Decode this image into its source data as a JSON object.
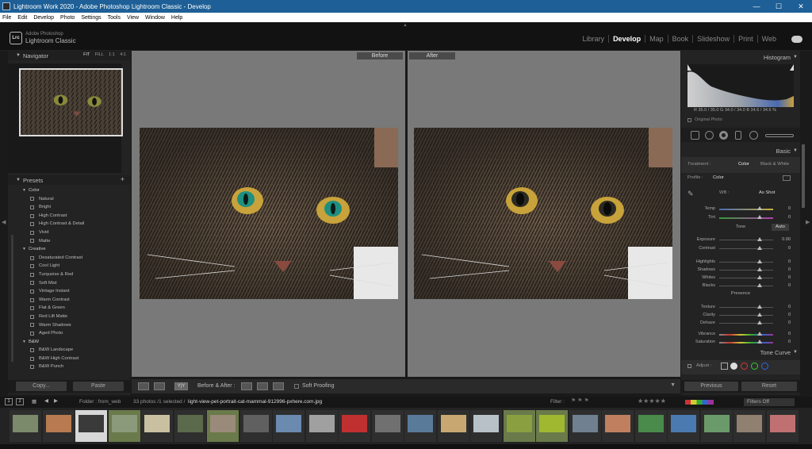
{
  "window": {
    "title": "Lightroom Work 2020 - Adobe Photoshop Lightroom Classic - Develop",
    "controls": [
      "—",
      "☐",
      "✕"
    ]
  },
  "menu": [
    "File",
    "Edit",
    "Develop",
    "Photo",
    "Settings",
    "Tools",
    "View",
    "Window",
    "Help"
  ],
  "brand": {
    "badge": "Lrc",
    "line1": "Adobe Photoshop",
    "line2": "Lightroom Classic"
  },
  "modules": [
    "Library",
    "Develop",
    "Map",
    "Book",
    "Slideshow",
    "Print",
    "Web"
  ],
  "active_module": "Develop",
  "navigator": {
    "title": "Navigator",
    "zoom": [
      "FIT",
      "FILL",
      "1:1",
      "4:1"
    ]
  },
  "presets": {
    "title": "Presets",
    "add": "+",
    "groups": [
      {
        "name": "Color",
        "items": [
          "Natural",
          "Bright",
          "High Contrast",
          "High Contrast & Detail",
          "Vivid",
          "Matte"
        ]
      },
      {
        "name": "Creative",
        "items": [
          "Desaturated Contrast",
          "Cool Light",
          "Turquoise & Red",
          "Soft Mist",
          "Vintage Instant",
          "Warm Contrast",
          "Flat & Green",
          "Red Lift Matte",
          "Warm Shadows",
          "Aged Photo"
        ]
      },
      {
        "name": "B&W",
        "items": [
          "B&W Landscape",
          "B&W High Contrast",
          "B&W Punch"
        ]
      }
    ]
  },
  "left_buttons": {
    "copy": "Copy...",
    "paste": "Paste"
  },
  "center": {
    "before_label": "Before",
    "after_label": "After"
  },
  "toolbar": {
    "ba_mode": "Y|Y",
    "ba_text": "Before & After :",
    "soft_proofing": "Soft Proofing"
  },
  "histogram": {
    "title": "Histogram",
    "readout": "R 35.0 / 35.0  G 34.0 / 34.0  B 34.6 / 34.6 %",
    "original_photo": "Original Photo"
  },
  "basic": {
    "title": "Basic",
    "treatment_label": "Treatment :",
    "treatment_color": "Color",
    "treatment_bw": "Black & White",
    "profile_label": "Profile :",
    "profile_value": "Color",
    "wb_label": "WB :",
    "wb_value": "As Shot",
    "tone_label": "Tone",
    "auto": "Auto",
    "presence_label": "Presence",
    "sliders": [
      {
        "label": "Temp",
        "value": "0"
      },
      {
        "label": "Tint",
        "value": "0"
      },
      {
        "label": "Exposure",
        "value": "0.00"
      },
      {
        "label": "Contrast",
        "value": "0"
      },
      {
        "label": "Highlights",
        "value": "0"
      },
      {
        "label": "Shadows",
        "value": "0"
      },
      {
        "label": "Whites",
        "value": "0"
      },
      {
        "label": "Blacks",
        "value": "0"
      },
      {
        "label": "Texture",
        "value": "0"
      },
      {
        "label": "Clarity",
        "value": "0"
      },
      {
        "label": "Dehaze",
        "value": "0"
      },
      {
        "label": "Vibrance",
        "value": "0"
      },
      {
        "label": "Saturation",
        "value": "0"
      }
    ]
  },
  "tone_curve": {
    "title": "Tone Curve",
    "adjust": "Adjust :"
  },
  "right_buttons": {
    "previous": "Previous",
    "reset": "Reset"
  },
  "filmstrip_bar": {
    "page1": "1",
    "page2": "2",
    "folder": "Folder : from_web",
    "count": "33 photos /1 selected /",
    "filename": "light-view-pet-portrait-cat-mammal-912996-pxhere.com.jpg",
    "filter_label": "Filter :",
    "filters_off": "Filters Off"
  },
  "colors": {
    "accent": "#1d5f96",
    "panel": "#232323",
    "canvas": "#797979"
  }
}
